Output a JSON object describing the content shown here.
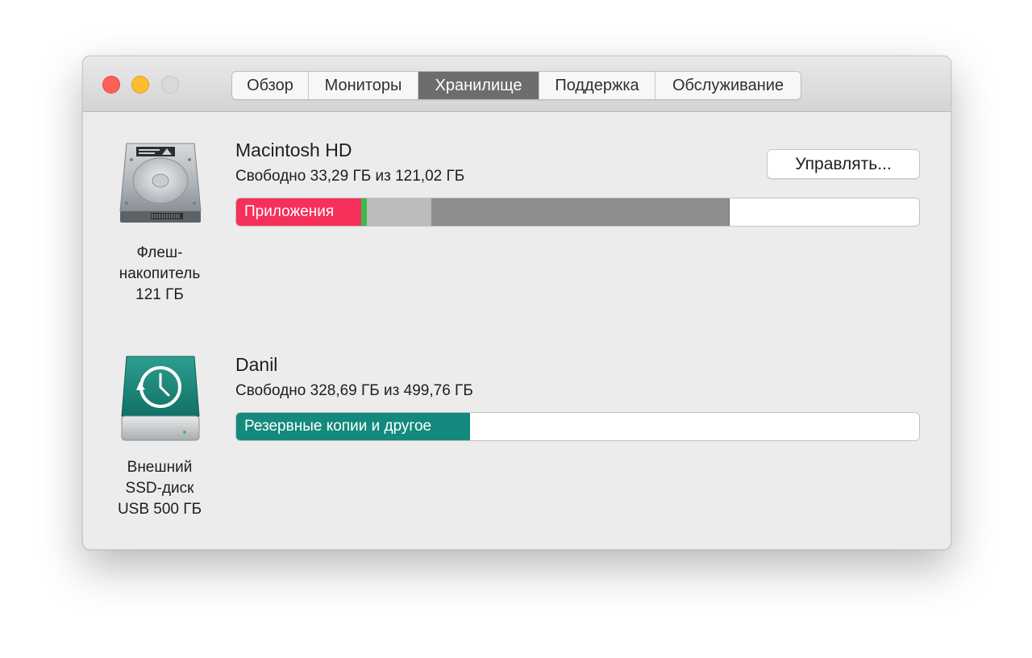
{
  "window": {
    "tabs": [
      {
        "label": "Обзор",
        "active": false
      },
      {
        "label": "Мониторы",
        "active": false
      },
      {
        "label": "Хранилище",
        "active": true
      },
      {
        "label": "Поддержка",
        "active": false
      },
      {
        "label": "Обслуживание",
        "active": false
      }
    ]
  },
  "disks": [
    {
      "icon": "hard-drive-icon",
      "label_lines": [
        "Флеш-",
        "накопитель",
        "121 ГБ"
      ],
      "volume_name": "Macintosh HD",
      "free_text": "Свободно 33,29 ГБ из 121,02 ГБ",
      "manage_label": "Управлять...",
      "bar_label": "Приложения",
      "segments_fraction": [
        0.183,
        0.008,
        0.094,
        0.437
      ],
      "segment_colors": [
        "#f5305a",
        "#3dbb4c",
        "#bcbcbd",
        "#8e8e90"
      ]
    },
    {
      "icon": "time-machine-drive-icon",
      "label_lines": [
        "Внешний",
        "SSD-диск",
        "USB 500 ГБ"
      ],
      "volume_name": "Danil",
      "free_text": "Свободно 328,69 ГБ из 499,76 ГБ",
      "bar_label": "Резервные копии и другое",
      "segments_fraction": [
        0.342
      ],
      "segment_colors": [
        "#138a7d"
      ]
    }
  ],
  "colors": {
    "traffic_close": "#fe5f57",
    "traffic_minimize": "#febc2e",
    "traffic_zoom": "#d9d9d9",
    "active_tab": "#6d6d6d"
  }
}
